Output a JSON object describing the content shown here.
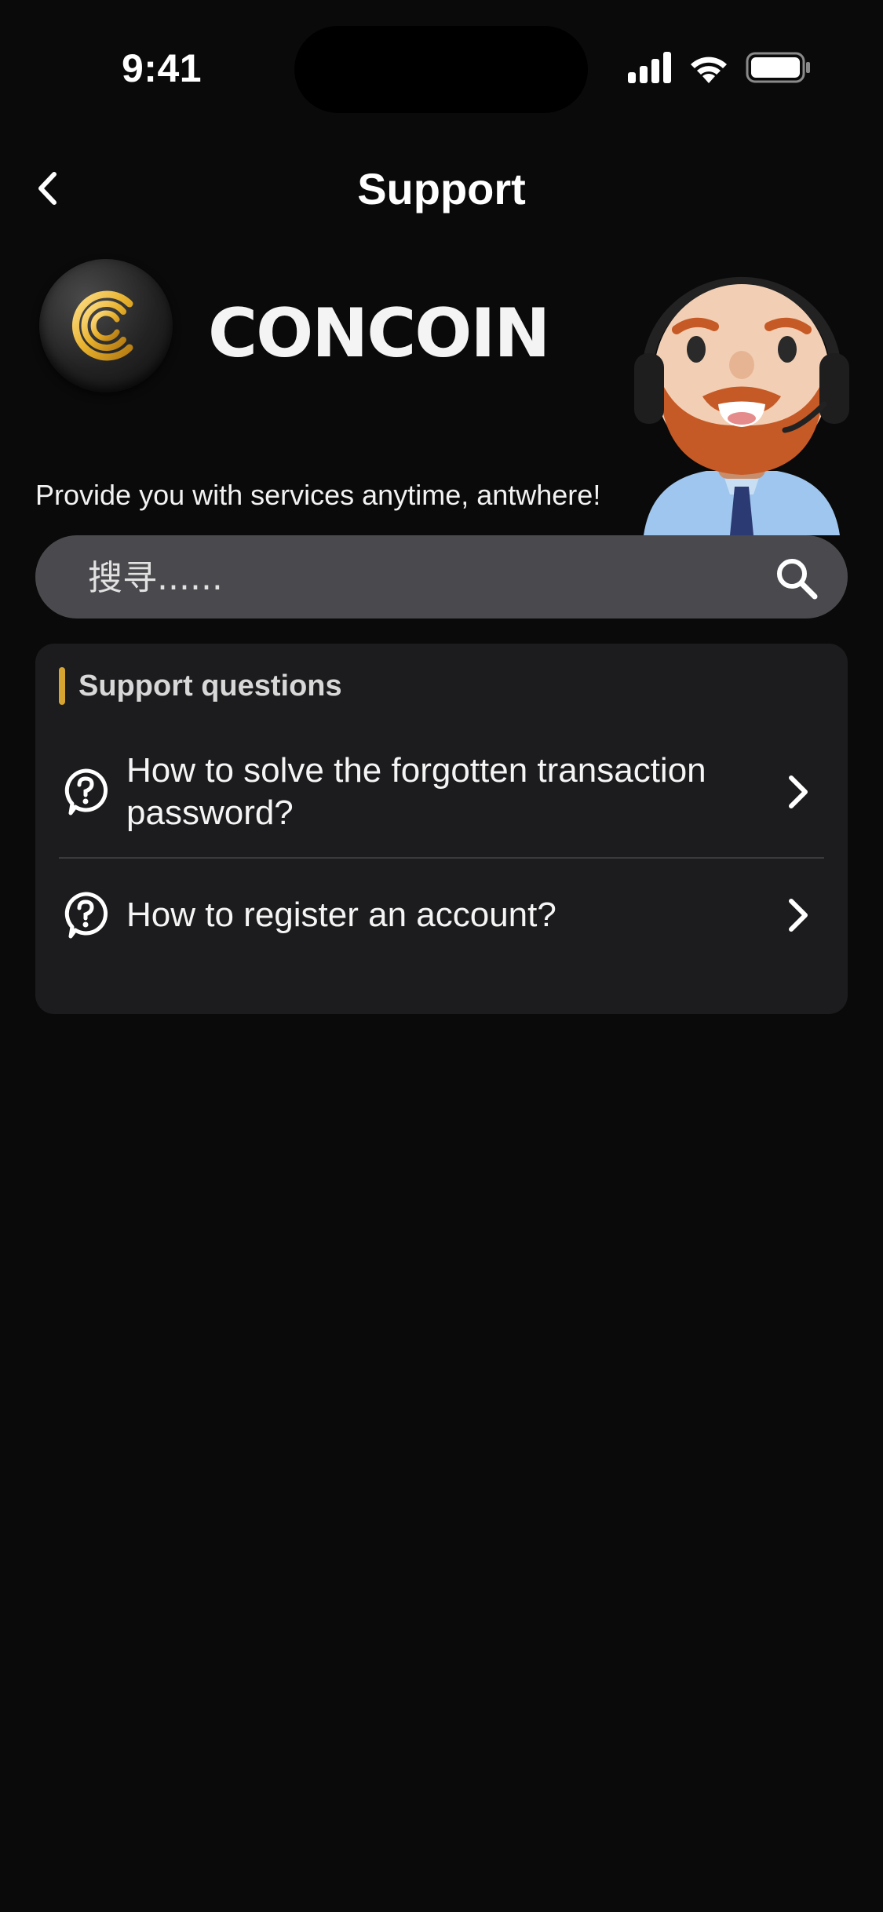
{
  "status_bar": {
    "time": "9:41"
  },
  "header": {
    "title": "Support"
  },
  "brand": {
    "name": "CONCOIN"
  },
  "tagline": "Provide you with services anytime, antwhere!",
  "search": {
    "placeholder": "搜寻......"
  },
  "support_card": {
    "title": "Support questions",
    "questions": [
      {
        "text": "How to solve the forgotten transaction password?"
      },
      {
        "text": "How to register an account?"
      }
    ]
  },
  "colors": {
    "background": "#0a0a0a",
    "card": "#1c1c1e",
    "search_bg": "#4a494d",
    "accent_gold": "#d6a531"
  }
}
